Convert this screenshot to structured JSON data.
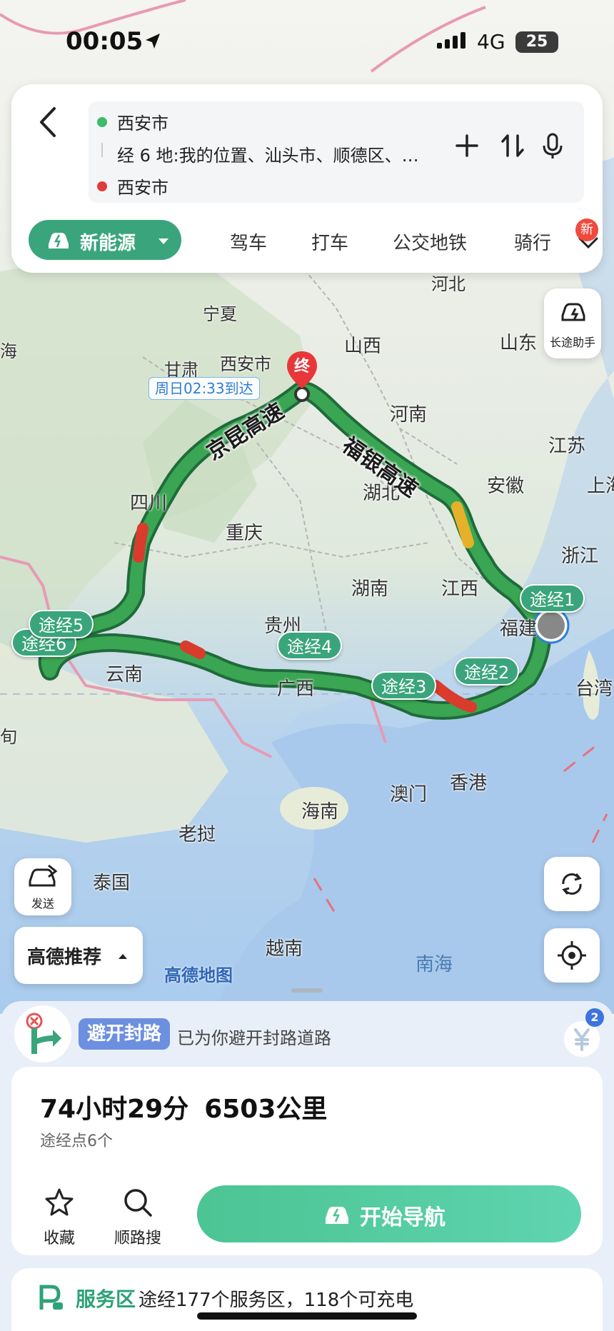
{
  "status_bar": {
    "time": "00:05",
    "network": "4G",
    "battery": "25"
  },
  "route_inputs": {
    "start": "西安市",
    "via": "经 6 地:我的位置、汕头市、顺德区、…",
    "end": "西安市"
  },
  "mode_tabs": {
    "ev": "新能源",
    "tabs": [
      "驾车",
      "打车",
      "公交地铁",
      "骑行"
    ],
    "new_badge": "新"
  },
  "map": {
    "labels": [
      "河北",
      "宁夏",
      "山西",
      "山东",
      "海",
      "甘肃",
      "西安市",
      "河南",
      "江苏",
      "四川",
      "湖北",
      "安徽",
      "上海",
      "重庆",
      "浙江",
      "湖南",
      "江西",
      "福建",
      "贵州",
      "云南",
      "广西",
      "台湾",
      "旬",
      "澳门",
      "香港",
      "海南",
      "老挝",
      "泰国",
      "越南",
      "南海"
    ],
    "roads": [
      "京昆高速",
      "福银高速"
    ],
    "arrival": "周日02:33到达",
    "end_marker": "终",
    "waypoints": [
      "途经1",
      "途经2",
      "途经3",
      "途经4",
      "途经5",
      "途经6"
    ],
    "logo": "高德地图"
  },
  "side_buttons": {
    "assistant": "长途助手",
    "send": "发送"
  },
  "recommend": "高德推荐",
  "notice": {
    "tag": "避开封路",
    "text": "已为你避开封路道路",
    "badge": "2"
  },
  "summary": {
    "duration": "74小时29分",
    "distance": "6503公里",
    "waypoints": "途经点6个"
  },
  "actions": {
    "favorite": "收藏",
    "search_along": "顺路搜",
    "start_nav": "开始导航"
  },
  "service": {
    "tag": "服务区",
    "text": "途经177个服务区，118个可充电"
  },
  "colors": {
    "primary": "#3aa57c",
    "route": "#2e8a4f",
    "congestion": "#d93b2c",
    "slow": "#e6b12a"
  }
}
